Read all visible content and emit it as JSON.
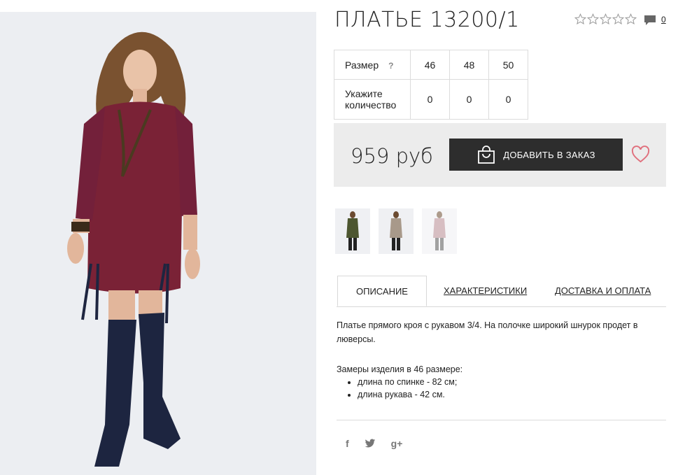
{
  "product": {
    "title": "ПЛАТЬЕ 13200/1",
    "rating_stars": 0,
    "rating_max": 5,
    "comments_count": "0"
  },
  "size_table": {
    "size_label": "Размер",
    "help_mark": "?",
    "sizes": [
      "46",
      "48",
      "50"
    ],
    "qty_label": "Укажите количество",
    "quantities": [
      "0",
      "0",
      "0"
    ]
  },
  "purchase": {
    "price": "959 руб",
    "add_button_label": "ДОБАВИТЬ В ЗАКАЗ"
  },
  "thumbnails": [
    {
      "name": "olive-dress"
    },
    {
      "name": "beige-dress"
    },
    {
      "name": "pink-dress"
    }
  ],
  "tabs": [
    "ОПИСАНИЕ",
    "ХАРАКТЕРИСТИКИ",
    "ДОСТАВКА И ОПЛАТА"
  ],
  "description": {
    "text": "Платье прямого кроя с рукавом 3/4. На полочке широкий шнурок продет в люверсы.",
    "measures_title": "Замеры изделия в 46 размере:",
    "measures": [
      "длина по спинке - 82 см;",
      "длина рукава - 42 см."
    ]
  },
  "social": {
    "facebook": "f",
    "twitter": "twitter-icon",
    "googleplus": "g+"
  },
  "colors": {
    "button_bg": "#2d2d2d",
    "price_bar_bg": "#ececec",
    "heart": "#e0707d",
    "dress": "#7a2236"
  }
}
